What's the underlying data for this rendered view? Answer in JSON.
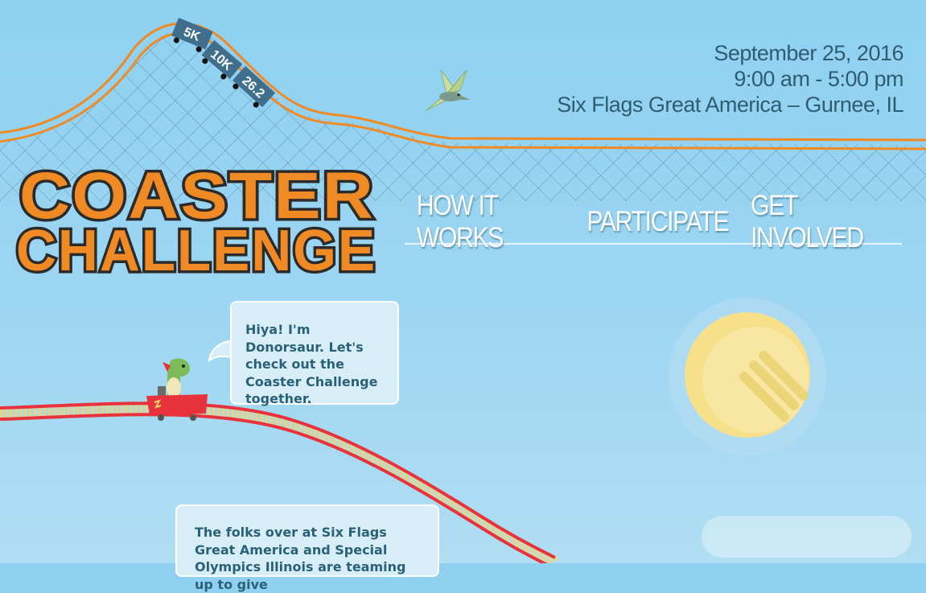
{
  "event": {
    "date": "September 25, 2016",
    "time": "9:00 am - 5:00 pm",
    "location": "Six Flags Great America – Gurnee, IL"
  },
  "logo": {
    "line1": "COASTER",
    "line2": "CHALLENGE"
  },
  "coaster_cars": [
    "5K",
    "10K",
    "26.2"
  ],
  "nav": {
    "items": [
      {
        "label": "HOW IT WORKS"
      },
      {
        "label": "PARTICIPATE"
      },
      {
        "label": "GET INVOLVED"
      }
    ]
  },
  "bubbles": {
    "intro": "Hiya! I'm Donorsaur. Let's check out the Coaster Challenge together.",
    "second": "The folks over at Six Flags Great America and Special Olympics Illinois are teaming up to give"
  },
  "colors": {
    "sky": "#8fd0f1",
    "orange": "#ef8a25",
    "track_red": "#e8323c",
    "text_dark": "#2e5d72",
    "logo_outline": "#2b2b2b"
  }
}
